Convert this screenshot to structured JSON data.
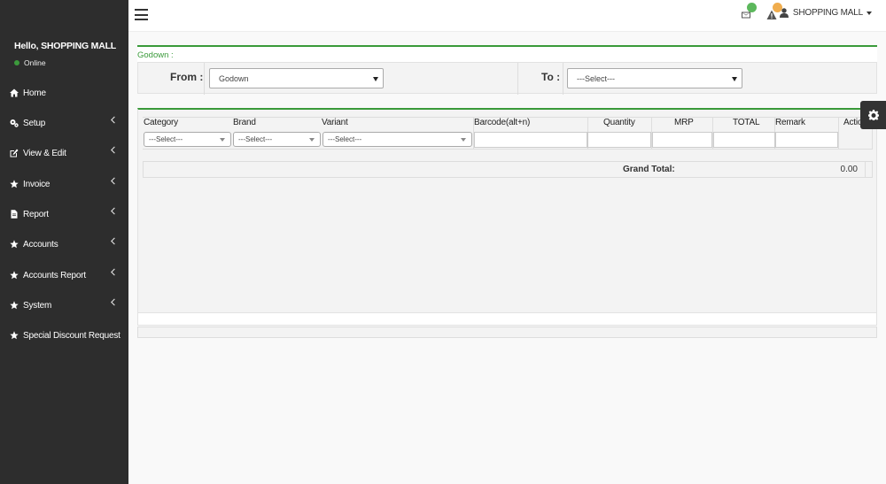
{
  "user_panel": {
    "greeting": "Hello, SHOPPING MALL",
    "status": "Online"
  },
  "menu": [
    {
      "label": "Home",
      "icon": "home-icon",
      "has_submenu": false
    },
    {
      "label": "Setup",
      "icon": "cogs-icon",
      "has_submenu": true
    },
    {
      "label": "View & Edit",
      "icon": "edit-icon",
      "has_submenu": true
    },
    {
      "label": "Invoice",
      "icon": "star-icon",
      "has_submenu": true
    },
    {
      "label": "Report",
      "icon": "file-icon",
      "has_submenu": true
    },
    {
      "label": "Accounts",
      "icon": "star-icon",
      "has_submenu": true
    },
    {
      "label": "Accounts Report",
      "icon": "star-icon",
      "has_submenu": true
    },
    {
      "label": "System",
      "icon": "star-icon",
      "has_submenu": true
    },
    {
      "label": "Special Discount Request",
      "icon": "star-icon",
      "has_submenu": false
    }
  ],
  "header": {
    "user_name": "SHOPPING MALL",
    "mail_badge_color": "#5cb85c",
    "alert_badge_color": "#f0ad4e"
  },
  "godown": {
    "title": "Godown :",
    "from_label": "From :",
    "from_value": "Godown",
    "to_label": "To :",
    "to_value": "---Select---"
  },
  "product_table": {
    "columns": [
      "Category",
      "Brand",
      "Variant",
      "Barcode(alt+n)",
      "Quantity",
      "MRP",
      "TOTAL",
      "Remark",
      "Action"
    ],
    "category_value": "---Select---",
    "brand_value": "---Select---",
    "variant_value": "---Select---",
    "grand_total_label": "Grand Total:",
    "grand_total_value": "0.00"
  },
  "colors": {
    "sidebar_bg": "#2d2d2d",
    "accent_green": "#3a9a3a"
  }
}
